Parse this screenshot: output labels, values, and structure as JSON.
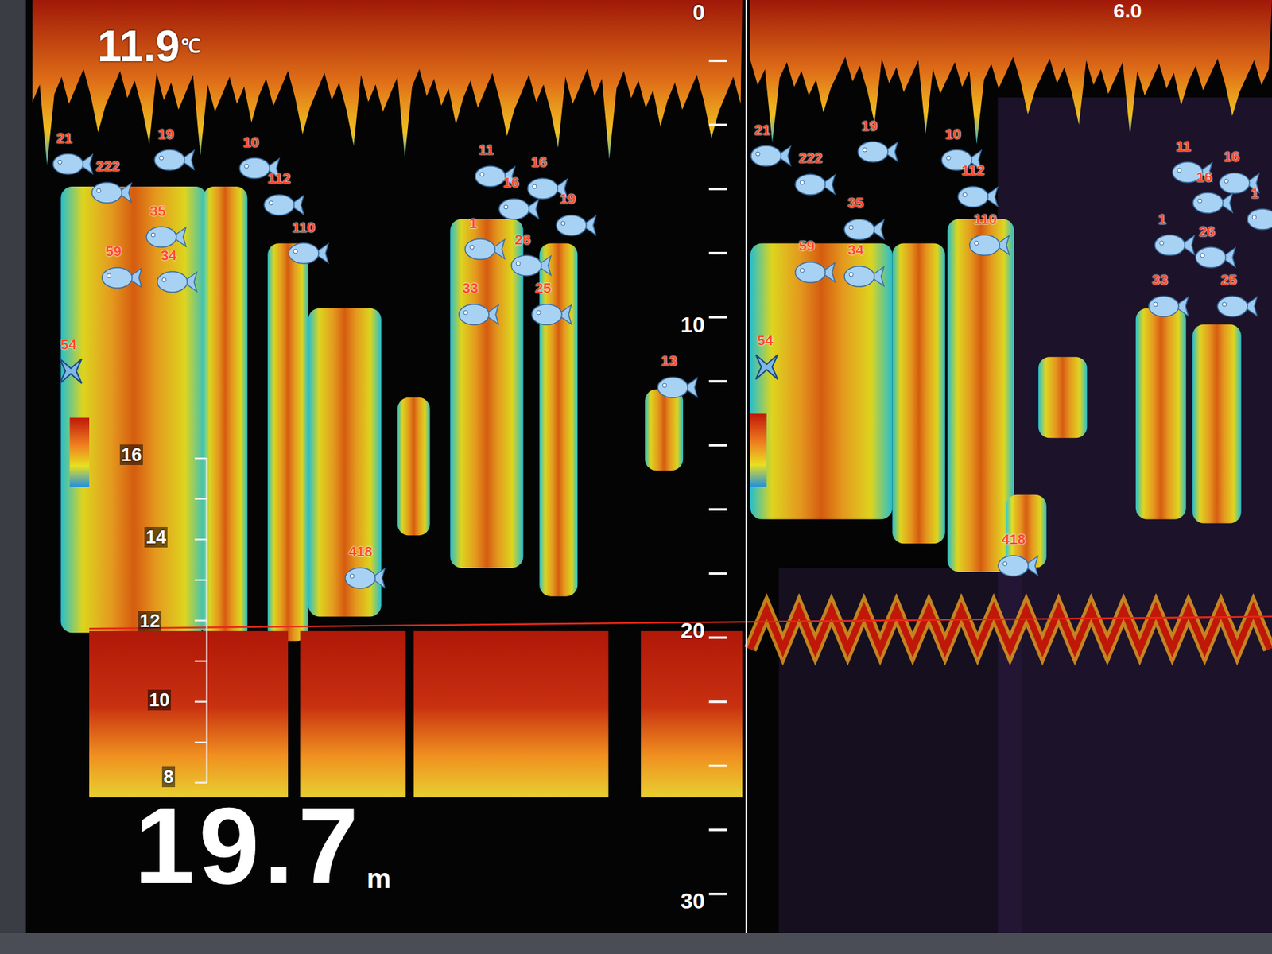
{
  "readout": {
    "temperature": "11.9",
    "temperature_unit": "℃",
    "depth": "19.7",
    "depth_unit": "m"
  },
  "depth_scale": [
    "0",
    "10",
    "20",
    "30"
  ],
  "range_right": "6.0",
  "gain_scale": [
    "16",
    "14",
    "12",
    "10",
    "8"
  ],
  "left_panel": {
    "targets": [
      {
        "label": "21",
        "kind": "fish"
      },
      {
        "label": "19",
        "kind": "fish"
      },
      {
        "label": "10",
        "kind": "fish"
      },
      {
        "label": "222",
        "kind": "fish"
      },
      {
        "label": "112",
        "kind": "fish"
      },
      {
        "label": "35",
        "kind": "fish"
      },
      {
        "label": "110",
        "kind": "fish"
      },
      {
        "label": "59",
        "kind": "fish"
      },
      {
        "label": "34",
        "kind": "fish"
      },
      {
        "label": "54",
        "kind": "marker"
      },
      {
        "label": "11",
        "kind": "fish"
      },
      {
        "label": "16",
        "kind": "fish"
      },
      {
        "label": "16",
        "kind": "fish"
      },
      {
        "label": "19",
        "kind": "fish"
      },
      {
        "label": "1",
        "kind": "fish"
      },
      {
        "label": "26",
        "kind": "fish"
      },
      {
        "label": "33",
        "kind": "fish"
      },
      {
        "label": "25",
        "kind": "fish"
      },
      {
        "label": "13",
        "kind": "fish"
      },
      {
        "label": "418",
        "kind": "fish"
      }
    ]
  },
  "right_panel": {
    "targets": [
      {
        "label": "21",
        "kind": "fish"
      },
      {
        "label": "19",
        "kind": "fish"
      },
      {
        "label": "10",
        "kind": "fish"
      },
      {
        "label": "222",
        "kind": "fish"
      },
      {
        "label": "112",
        "kind": "fish"
      },
      {
        "label": "35",
        "kind": "fish"
      },
      {
        "label": "110",
        "kind": "fish"
      },
      {
        "label": "59",
        "kind": "fish"
      },
      {
        "label": "34",
        "kind": "fish"
      },
      {
        "label": "54",
        "kind": "marker"
      },
      {
        "label": "418",
        "kind": "fish"
      },
      {
        "label": "11",
        "kind": "fish"
      },
      {
        "label": "16",
        "kind": "fish"
      },
      {
        "label": "16",
        "kind": "fish"
      },
      {
        "label": "1",
        "kind": "fish"
      },
      {
        "label": "1",
        "kind": "fish"
      },
      {
        "label": "26",
        "kind": "fish"
      },
      {
        "label": "33",
        "kind": "fish"
      },
      {
        "label": "25",
        "kind": "fish"
      }
    ]
  }
}
